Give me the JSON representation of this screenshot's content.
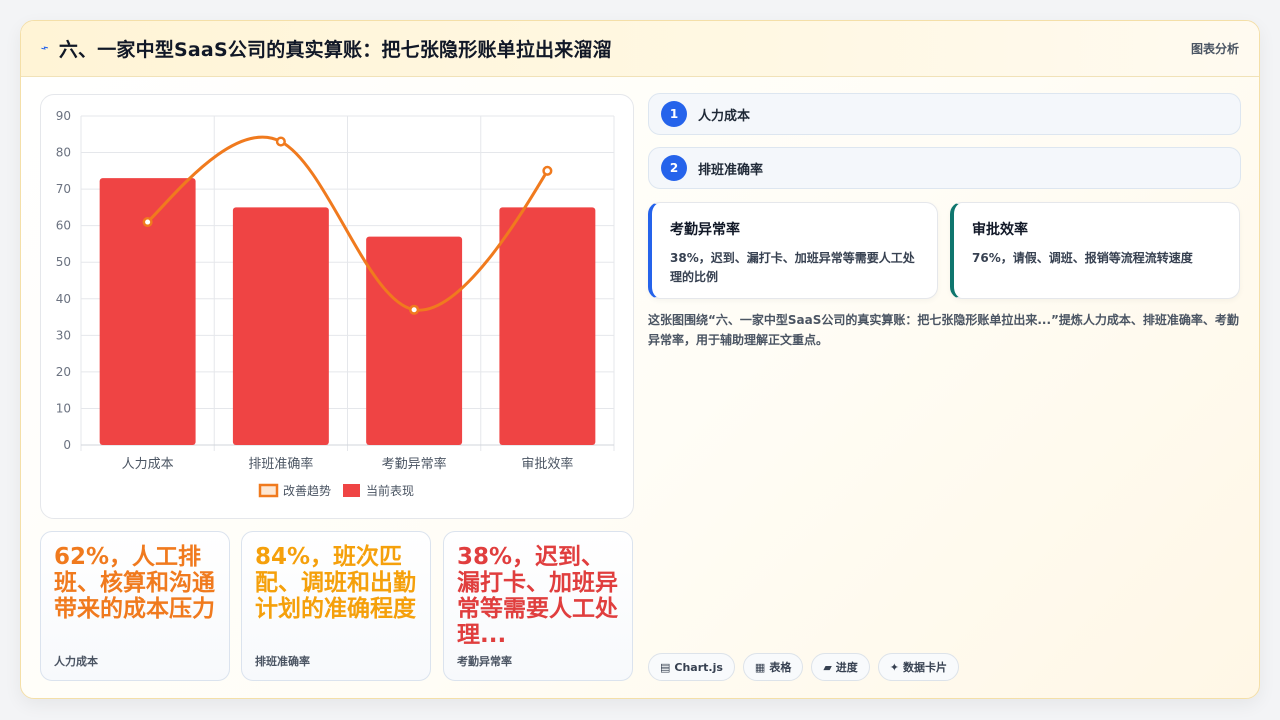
{
  "header": {
    "title": "六、一家中型SaaS公司的真实算账：把七张隐形账单拉出来溜溜",
    "tag": "图表分析",
    "icon": "bolt-icon"
  },
  "chart_data": {
    "type": "bar",
    "categories": [
      "人力成本",
      "排班准确率",
      "考勤异常率",
      "审批效率"
    ],
    "series": [
      {
        "name": "当前表现",
        "type": "bar",
        "color": "#ef4444",
        "values": [
          73,
          65,
          57,
          65
        ]
      },
      {
        "name": "改善趋势",
        "type": "line",
        "color": "#f07a1e",
        "values": [
          61,
          83,
          37,
          75
        ]
      }
    ],
    "yticks": [
      "0",
      "10",
      "20",
      "30",
      "40",
      "50",
      "60",
      "70",
      "80",
      "90"
    ],
    "ylim": [
      0,
      90
    ],
    "grid": true,
    "legend_position": "bottom"
  },
  "stats": [
    {
      "value": "62%，人工排班、核算和沟通带来的成本压力",
      "label": "人力成本",
      "color": "#f07a1e"
    },
    {
      "value": "84%，班次匹配、调班和出勤计划的准确程度",
      "label": "排班准确率",
      "color": "#f5a00b"
    },
    {
      "value": "38%，迟到、漏打卡、加班异常等需要人工处理...",
      "label": "考勤异常率",
      "color": "#e03e3e"
    }
  ],
  "items": [
    {
      "num": "1",
      "label": "人力成本"
    },
    {
      "num": "2",
      "label": "排班准确率"
    }
  ],
  "metrics": [
    {
      "title": "考勤异常率",
      "desc": "38%，迟到、漏打卡、加班异常等需要人工处理的比例",
      "accent": "#2563eb"
    },
    {
      "title": "审批效率",
      "desc": "76%，请假、调班、报销等流程流转速度",
      "accent": "#0f766e"
    }
  ],
  "summary": "这张图围绕“六、一家中型SaaS公司的真实算账：把七张隐形账单拉出来...”提炼人力成本、排班准确率、考勤异常率，用于辅助理解正文重点。",
  "chips": [
    {
      "icon": "▤",
      "label": "Chart.js"
    },
    {
      "icon": "▦",
      "label": "表格"
    },
    {
      "icon": "▰",
      "label": "进度"
    },
    {
      "icon": "✦",
      "label": "数据卡片"
    }
  ]
}
